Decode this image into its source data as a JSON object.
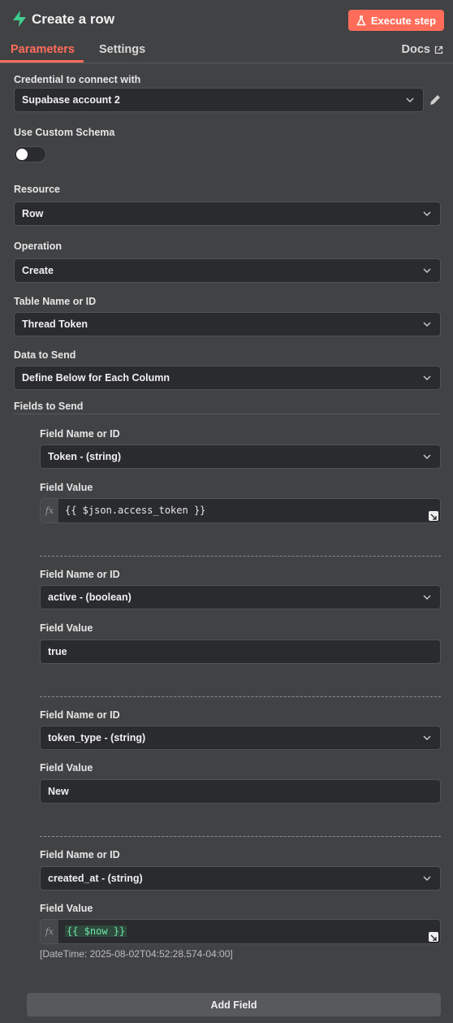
{
  "header": {
    "title": "Create a row",
    "execute_label": "Execute step",
    "logo_icon": "supabase-bolt-icon",
    "accent": "#ff6d5a",
    "logo_color": "#3ecf8e"
  },
  "tabs": {
    "parameters": "Parameters",
    "settings": "Settings",
    "docs": "Docs"
  },
  "credential": {
    "label": "Credential to connect with",
    "value": "Supabase account 2"
  },
  "custom_schema": {
    "label": "Use Custom Schema",
    "enabled": false
  },
  "resource": {
    "label": "Resource",
    "value": "Row"
  },
  "operation": {
    "label": "Operation",
    "value": "Create"
  },
  "table": {
    "label": "Table Name or ID",
    "value": "Thread Token"
  },
  "data_to_send": {
    "label": "Data to Send",
    "value": "Define Below for Each Column"
  },
  "fields_to_send": {
    "label": "Fields to Send",
    "fields": [
      {
        "name_label": "Field Name or ID",
        "name_value": "Token - (string)",
        "value_label": "Field Value",
        "value": "{{ $json.access_token }}",
        "is_expression": true
      },
      {
        "name_label": "Field Name or ID",
        "name_value": "active - (boolean)",
        "value_label": "Field Value",
        "value": "true",
        "is_expression": false
      },
      {
        "name_label": "Field Name or ID",
        "name_value": "token_type - (string)",
        "value_label": "Field Value",
        "value": "New",
        "is_expression": false
      },
      {
        "name_label": "Field Name or ID",
        "name_value": "created_at - (string)",
        "value_label": "Field Value",
        "value": "{{ $now }}",
        "is_expression": true,
        "hint": "[DateTime: 2025-08-02T04:52:28.574-04:00]"
      }
    ],
    "add_field_label": "Add Field"
  },
  "fx_glyph": "fx"
}
